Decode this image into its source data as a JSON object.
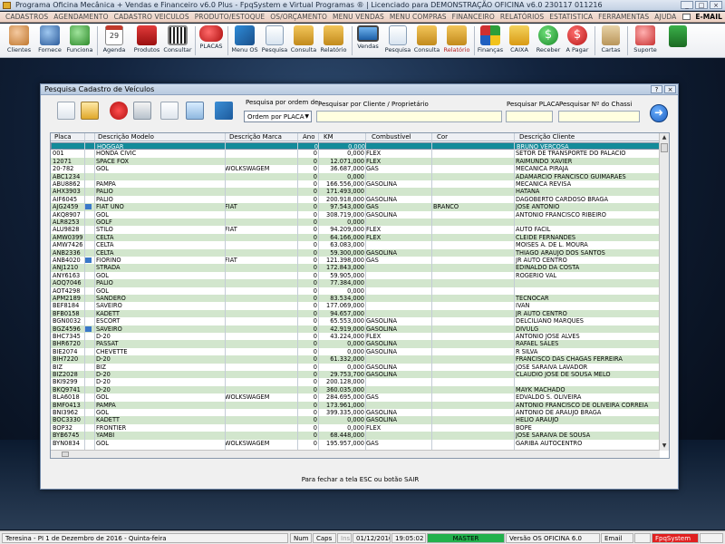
{
  "window_title": "Programa Oficina Mecânica + Vendas e Financeiro v6.0 Plus - FpqSystem e Virtual Programas ® | Licenciado para  DEMONSTRAÇÃO OFICINA v6.0 230117 011216",
  "menu": [
    "CADASTROS",
    "AGENDAMENTO",
    "CADASTRO VEICULOS",
    "PRODUTO/ESTOQUE",
    "OS/ORÇAMENTO",
    "MENU VENDAS",
    "MENU COMPRAS",
    "FINANCEIRO",
    "RELATÓRIOS",
    "ESTATISTICA",
    "FERRAMENTAS",
    "AJUDA"
  ],
  "menu_email": "E-MAIL",
  "toolbar": [
    "Clientes",
    "Fornece",
    "Funciona",
    "Agenda",
    "Produtos",
    "Consultar",
    "PLACAS",
    "Menu OS",
    "Pesquisa",
    "Consulta",
    "Relatório",
    "Vendas",
    "Pesquisa",
    "Consulta",
    "Relatório",
    "Finanças",
    "CAIXA",
    "Receber",
    "A Pagar",
    "Cartas",
    "Suporte"
  ],
  "agenda_day": "29",
  "dialog": {
    "title": "Pesquisa Cadastro de Veículos",
    "order_label": "Pesquisa por ordem de:",
    "order_value": "Ordem por PLACA",
    "client_label": "Pesquisar por Cliente / Proprietário",
    "placa_label": "Pesquisar PLACA",
    "chassi_label": "Pesquisar Nº do Chassi",
    "hint": "Para fechar a tela ESC ou botão SAIR"
  },
  "columns": [
    "Placa",
    "Descrição Modelo",
    "Descrição Marca",
    "Ano",
    "KM",
    "Combustível",
    "Cor",
    "Descrição Cliente"
  ],
  "rows": [
    [
      "",
      "HOGGAR",
      "",
      "0",
      "0,000",
      "",
      "",
      "BRUNO VERCOSA",
      ""
    ],
    [
      "001",
      "HONDA CIVIC",
      "",
      "0",
      "0,000",
      "FLEX",
      "",
      "SETOR DE TRANSPORTE DO PALACIO",
      ""
    ],
    [
      "12071",
      "SPACE FOX",
      "",
      "0",
      "12.071,000",
      "FLEX",
      "",
      "RAIMUNDO XAVIER",
      ""
    ],
    [
      "20-782",
      "GOL",
      "WOLKSWAGEM",
      "0",
      "36.687,000",
      "GAS",
      "",
      "MECANICA PIRAJA",
      ""
    ],
    [
      "ABC1234",
      "",
      "",
      "0",
      "0,000",
      "",
      "",
      "ADAMARCIO FRANCISCO GUIMARAES",
      ""
    ],
    [
      "ABU8862",
      "PAMPA",
      "",
      "0",
      "166.556,000",
      "GASOLINA",
      "",
      "MECANICA REVISA",
      ""
    ],
    [
      "AHX3903",
      "PALIO",
      "",
      "0",
      "171.493,000",
      "",
      "",
      "HATANA",
      ""
    ],
    [
      "AIF6045",
      "PALIO",
      "",
      "0",
      "200.918,000",
      "GASOLINA",
      "",
      "DAGOBERTO CARDOSO BRAGA",
      ""
    ],
    [
      "AJG2459",
      "FIAT UNO",
      "FIAT",
      "0",
      "97.543,000",
      "GAS",
      "BRANCO",
      "JOSE ANTONIO",
      "y"
    ],
    [
      "AKQ8907",
      "GOL",
      "",
      "0",
      "308.719,000",
      "GASOLINA",
      "",
      "ANTONIO FRANCISCO RIBEIRO",
      ""
    ],
    [
      "ALR8253",
      "GOLF",
      "",
      "0",
      "0,000",
      "",
      "",
      "",
      ""
    ],
    [
      "ALU9828",
      "STILO",
      "FIAT",
      "0",
      "94.209,000",
      "FLEX",
      "",
      "AUTO FACIL",
      ""
    ],
    [
      "AMW0399",
      "CELTA",
      "",
      "0",
      "64.166,000",
      "FLEX",
      "",
      "CLEIDE FERNANDES",
      ""
    ],
    [
      "AMW7426",
      "CELTA",
      "",
      "0",
      "63.083,000",
      "",
      "",
      "MOISES A. DE L. MOURA",
      ""
    ],
    [
      "ANB2336",
      "CELTA",
      "",
      "0",
      "59.300,000",
      "GASOLINA",
      "",
      "THIAGO ARAUJO DOS SANTOS",
      ""
    ],
    [
      "ANB4020",
      "FIORINO",
      "FIAT",
      "0",
      "121.398,000",
      "GAS",
      "",
      "JR AUTO CENTRO",
      "y"
    ],
    [
      "ANJ1210",
      "STRADA",
      "",
      "0",
      "172.843,000",
      "",
      "",
      "EDINALDO DA COSTA",
      ""
    ],
    [
      "ANY6163",
      "GOL",
      "",
      "0",
      "59.905,000",
      "",
      "",
      "ROGERIO VAL",
      ""
    ],
    [
      "AOQ7046",
      "PALIO",
      "",
      "0",
      "77.384,000",
      "",
      "",
      "",
      ""
    ],
    [
      "AOT4298",
      "GOL",
      "",
      "0",
      "0,000",
      "",
      "",
      "",
      ""
    ],
    [
      "APM2189",
      "SANDERO",
      "",
      "0",
      "83.534,000",
      "",
      "",
      "TECNOCAR",
      ""
    ],
    [
      "BEF8184",
      "SAVEIRO",
      "",
      "0",
      "177.069,000",
      "",
      "",
      "IVAN",
      ""
    ],
    [
      "BFB0158",
      "KADETT",
      "",
      "0",
      "94.657,000",
      "",
      "",
      "JR AUTO CENTRO",
      ""
    ],
    [
      "BGN0032",
      "ESCORT",
      "",
      "0",
      "65.553,000",
      "GASOLINA",
      "",
      "DELCILIANO MARQUES",
      ""
    ],
    [
      "BGZ4596",
      "SAVEIRO",
      "",
      "0",
      "42.919,000",
      "GASOLINA",
      "",
      "DIVULG",
      "y"
    ],
    [
      "BHC7345",
      "D-20",
      "",
      "0",
      "43.224,000",
      "FLEX",
      "",
      "ANTONIO JOSE ALVES",
      ""
    ],
    [
      "BHR6720",
      "PASSAT",
      "",
      "0",
      "0,000",
      "GASOLINA",
      "",
      "RAFAEL SALES",
      ""
    ],
    [
      "BIE2074",
      "CHEVETTE",
      "",
      "0",
      "0,000",
      "GASOLINA",
      "",
      "R SILVA",
      ""
    ],
    [
      "BIH7220",
      "D-20",
      "",
      "0",
      "61.332,000",
      "",
      "",
      "FRANCISCO DAS CHAGAS FERREIRA",
      ""
    ],
    [
      "BIZ",
      "BIZ",
      "",
      "0",
      "0,000",
      "GASOLINA",
      "",
      "JOSE SARAIVA LAVADOR",
      ""
    ],
    [
      "BIZ2028",
      "D-20",
      "",
      "0",
      "29.753,700",
      "GASOLINA",
      "",
      "CLAUDIO JOSE DE SOUSA MELO",
      ""
    ],
    [
      "BKI9299",
      "D-20",
      "",
      "0",
      "200.128,000",
      "",
      "",
      "",
      ""
    ],
    [
      "BKQ9741",
      "D-20",
      "",
      "0",
      "360.035,000",
      "",
      "",
      "MAYK MACHADO",
      ""
    ],
    [
      "BLA6018",
      "GOL",
      "WOLKSWAGEM",
      "0",
      "284.695,000",
      "GAS",
      "",
      "EDVALDO S. OLIVEIRA",
      ""
    ],
    [
      "BMF0413",
      "PAMPA",
      "",
      "0",
      "173.961,000",
      "",
      "",
      "ANTONIO FRANCISCO DE OLIVEIRA CORREIA",
      ""
    ],
    [
      "BNI3962",
      "GOL",
      "",
      "0",
      "399.335,000",
      "GASOLINA",
      "",
      "ANTONIO DE ARAUJO BRAGA",
      ""
    ],
    [
      "BOC3330",
      "KADETT",
      "",
      "0",
      "0,000",
      "GASOLINA",
      "",
      "HELIO ARAUJO",
      ""
    ],
    [
      "BOP32",
      "FRONTIER",
      "",
      "0",
      "0,000",
      "FLEX",
      "",
      "BOPE",
      ""
    ],
    [
      "BYB6745",
      "YAMBI",
      "",
      "0",
      "68.448,000",
      "",
      "",
      "JOSE SARAIVA DE SOUSA",
      ""
    ],
    [
      "BYN0834",
      "GOL",
      "WOLKSWAGEM",
      "0",
      "195.957,000",
      "GAS",
      "",
      "GARIBA AUTOCENTRO",
      ""
    ]
  ],
  "status": {
    "location": "Teresina - PI  1 de Dezembro de 2016 - Quinta-feira",
    "num": "Num",
    "caps": "Caps",
    "ins": "Ins",
    "date": "01/12/2016",
    "time": "19:05:02",
    "master": "MASTER",
    "version": "Versão OS OFICINA 6.0",
    "email": "Email",
    "brand": "FpqSystem"
  }
}
